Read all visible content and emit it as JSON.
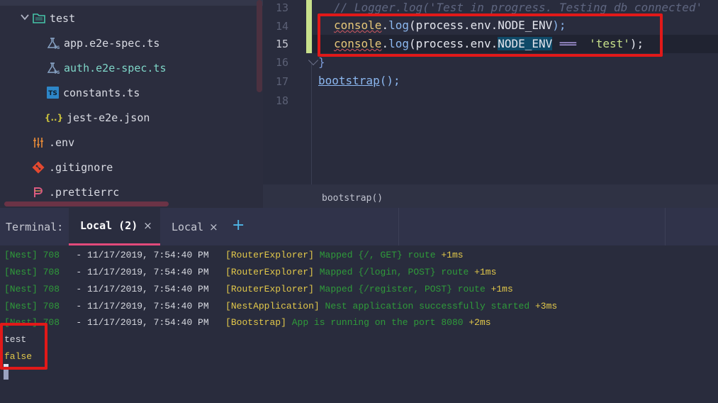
{
  "sidebar": {
    "folder": {
      "name": "test",
      "icon": "folder-icon"
    },
    "files": [
      {
        "name": "app.e2e-spec.ts",
        "icon": "test-flask-icon"
      },
      {
        "name": "auth.e2e-spec.ts",
        "icon": "test-flask-icon"
      },
      {
        "name": "constants.ts",
        "icon": "typescript-file-icon",
        "icon_text": "TS"
      },
      {
        "name": "jest-e2e.json",
        "icon": "json-file-icon",
        "icon_text": "{..}"
      }
    ],
    "root_files": [
      {
        "name": ".env",
        "icon": "env-settings-icon"
      },
      {
        "name": ".gitignore",
        "icon": "git-icon"
      },
      {
        "name": ".prettierrc",
        "icon": "prettier-icon"
      }
    ]
  },
  "editor": {
    "line_numbers": [
      "13",
      "14",
      "15",
      "16",
      "17",
      "18"
    ],
    "current_line": "15",
    "line13": "// Logger.log('Test in progress. Testing db connected'",
    "line14": {
      "obj": "console",
      "method": "log",
      "open": "(process.env.",
      "prop": "NODE_ENV",
      "close": ");"
    },
    "line15": {
      "obj": "console",
      "method": "log",
      "open": "(process.env.",
      "prop": "NODE_ENV",
      "op": "===",
      "str": "'test'",
      "close": ");"
    },
    "line16": "}",
    "line17": {
      "fn": "bootstrap",
      "rest": "();"
    },
    "breadcrumb": "bootstrap()"
  },
  "terminal": {
    "title": "Terminal:",
    "tabs": [
      {
        "label": "Local (2)",
        "active": true
      },
      {
        "label": "Local",
        "active": false
      }
    ],
    "add_symbol": "+",
    "close_symbol": "×",
    "logs": [
      {
        "prefix": "[Nest] 708",
        "sep": "   - ",
        "time": "11/17/2019, 7:54:40 PM",
        "ctx": "[RouterExplorer]",
        "msg": "Mapped {/, GET} route",
        "delta": "+1ms"
      },
      {
        "prefix": "[Nest] 708",
        "sep": "   - ",
        "time": "11/17/2019, 7:54:40 PM",
        "ctx": "[RouterExplorer]",
        "msg": "Mapped {/login, POST} route",
        "delta": "+1ms"
      },
      {
        "prefix": "[Nest] 708",
        "sep": "   - ",
        "time": "11/17/2019, 7:54:40 PM",
        "ctx": "[RouterExplorer]",
        "msg": "Mapped {/register, POST} route",
        "delta": "+1ms"
      },
      {
        "prefix": "[Nest] 708",
        "sep": "   - ",
        "time": "11/17/2019, 7:54:40 PM",
        "ctx": "[NestApplication]",
        "msg": "Nest application successfully started",
        "delta": "+3ms"
      },
      {
        "prefix": "[Nest] 708",
        "sep": "   - ",
        "time": "11/17/2019, 7:54:40 PM",
        "ctx": "[Bootstrap]",
        "msg": "App is running on the port 8080",
        "delta": "+2ms"
      }
    ],
    "output": [
      "test",
      "false"
    ]
  },
  "colors": {
    "highlight_box": "#e11919",
    "active_tab_underline": "#e24a7b",
    "log_green": "#2f9b3a",
    "log_yellow": "#e2c84a"
  }
}
